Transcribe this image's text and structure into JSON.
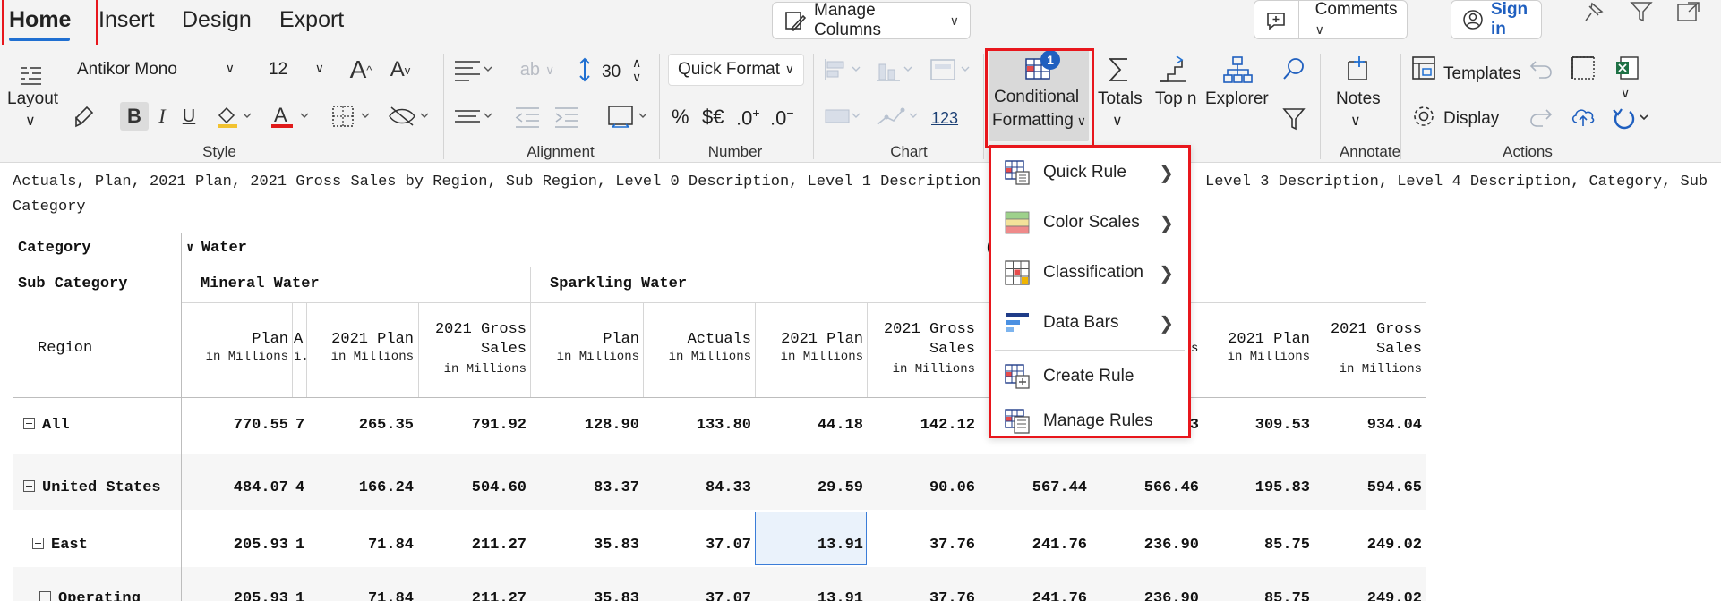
{
  "tabs": {
    "home": "Home",
    "insert": "Insert",
    "design": "Design",
    "export": "Export"
  },
  "topbar": {
    "manage_columns": "Manage Columns",
    "comments": "Comments",
    "sign_in": "Sign in"
  },
  "ribbon": {
    "layout": "Layout",
    "font_name": "Antikor Mono",
    "font_size": "12",
    "bold": "B",
    "italic": "I",
    "underline": "U",
    "row_height": "30",
    "quick_format": "Quick Format",
    "percent": "%",
    "currency": "$€",
    "decimals_up": ".0",
    "decimals_down": ".0",
    "number_123": "123",
    "conditional_1": "Conditional",
    "conditional_2": "Formatting",
    "conditional_badge": "1",
    "totals": "Totals",
    "topn": "Top n",
    "explorer": "Explorer",
    "notes": "Notes",
    "templates": "Templates",
    "display": "Display",
    "groups": {
      "style": "Style",
      "alignment": "Alignment",
      "number": "Number",
      "chart": "Chart",
      "annotate": "Annotate",
      "actions": "Actions"
    }
  },
  "fields_line_1a": "Actuals, Plan, 2021 Plan, 2021 Gross Sales by Region, Sub Region, Level 0 Description, Level 1 Description",
  "fields_line_1b": "Level 3 Description, Level 4 Description, Category, Sub",
  "fields_line_2": "Category",
  "menu": {
    "items": [
      "Quick Rule",
      "Color Scales",
      "Classification",
      "Data Bars",
      "Create Rule",
      "Manage Rules"
    ]
  },
  "grid": {
    "row_headers": {
      "category": "Category",
      "sub_category": "Sub Category",
      "region": "Region"
    },
    "category_water": "Water",
    "category_partial": "(",
    "sub_mineral": "Mineral Water",
    "sub_sparkling": "Sparkling Water",
    "unit": "in Millions",
    "col_headers": [
      {
        "l1": "Plan",
        "l2": ""
      },
      {
        "l1": "A.",
        "l2": ""
      },
      {
        "l1": "2021 Plan",
        "l2": ""
      },
      {
        "l1": "2021 Gross",
        "l2": "Sales"
      },
      {
        "l1": "Plan",
        "l2": ""
      },
      {
        "l1": "Actuals",
        "l2": ""
      },
      {
        "l1": "2021 Plan",
        "l2": ""
      },
      {
        "l1": "2021 Gross",
        "l2": "Sales"
      },
      {
        "l1": "",
        "l2": ""
      },
      {
        "l1": "",
        "l2": ""
      },
      {
        "l1": "2021 Plan",
        "l2": ""
      },
      {
        "l1": "2021 Gross",
        "l2": "Sales"
      }
    ],
    "col9_unit_partial": "s",
    "rows": [
      {
        "label": "All",
        "values": [
          "770.55",
          "7",
          "265.35",
          "791.92",
          "128.90",
          "133.80",
          "44.18",
          "142.12",
          "",
          "3",
          "309.53",
          "934.04"
        ]
      },
      {
        "label": "United States",
        "values": [
          "484.07",
          "4",
          "166.24",
          "504.60",
          "83.37",
          "84.33",
          "29.59",
          "90.06",
          "567.44",
          "566.46",
          "195.83",
          "594.65"
        ]
      },
      {
        "label": "East",
        "values": [
          "205.93",
          "1",
          "71.84",
          "211.27",
          "35.83",
          "37.07",
          "13.91",
          "37.76",
          "241.76",
          "236.90",
          "85.75",
          "249.02"
        ]
      },
      {
        "label": "Operating",
        "values": [
          "205.93",
          "1",
          "71.84",
          "211.27",
          "35.83",
          "37.07",
          "13.91",
          "37.76",
          "241.76",
          "236.90",
          "85.75",
          "249.02"
        ]
      }
    ]
  }
}
